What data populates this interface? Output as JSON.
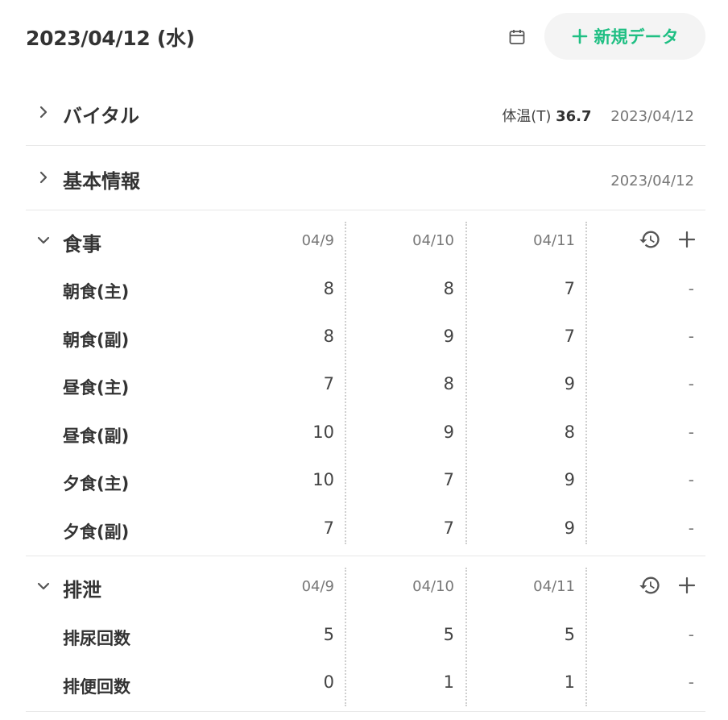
{
  "header": {
    "date": "2023/04/12 (水)",
    "new_button_label": "新規データ"
  },
  "vital": {
    "title": "バイタル",
    "metric_label": "体温(T)",
    "metric_value": "36.7",
    "date": "2023/04/12"
  },
  "basic": {
    "title": "基本情報",
    "date": "2023/04/12"
  },
  "meal": {
    "title": "食事",
    "columns": [
      "04/9",
      "04/10",
      "04/11"
    ],
    "rows": [
      {
        "label": "朝食(主)",
        "values": [
          "8",
          "8",
          "7"
        ],
        "extra": "-"
      },
      {
        "label": "朝食(副)",
        "values": [
          "8",
          "9",
          "7"
        ],
        "extra": "-"
      },
      {
        "label": "昼食(主)",
        "values": [
          "7",
          "8",
          "9"
        ],
        "extra": "-"
      },
      {
        "label": "昼食(副)",
        "values": [
          "10",
          "9",
          "8"
        ],
        "extra": "-"
      },
      {
        "label": "夕食(主)",
        "values": [
          "10",
          "7",
          "9"
        ],
        "extra": "-"
      },
      {
        "label": "夕食(副)",
        "values": [
          "7",
          "7",
          "9"
        ],
        "extra": "-"
      }
    ]
  },
  "excretion": {
    "title": "排泄",
    "columns": [
      "04/9",
      "04/10",
      "04/11"
    ],
    "rows": [
      {
        "label": "排尿回数",
        "values": [
          "5",
          "5",
          "5"
        ],
        "extra": "-"
      },
      {
        "label": "排便回数",
        "values": [
          "0",
          "1",
          "1"
        ],
        "extra": "-"
      }
    ]
  },
  "colors": {
    "accent": "#1fbf83",
    "text": "#333333",
    "muted": "#777777",
    "divider": "#e8e8e8"
  },
  "icons": {
    "calendar": "calendar-icon",
    "plus": "plus-icon",
    "chevron_right": "chevron-right-icon",
    "chevron_down": "chevron-down-icon",
    "history": "history-icon"
  }
}
